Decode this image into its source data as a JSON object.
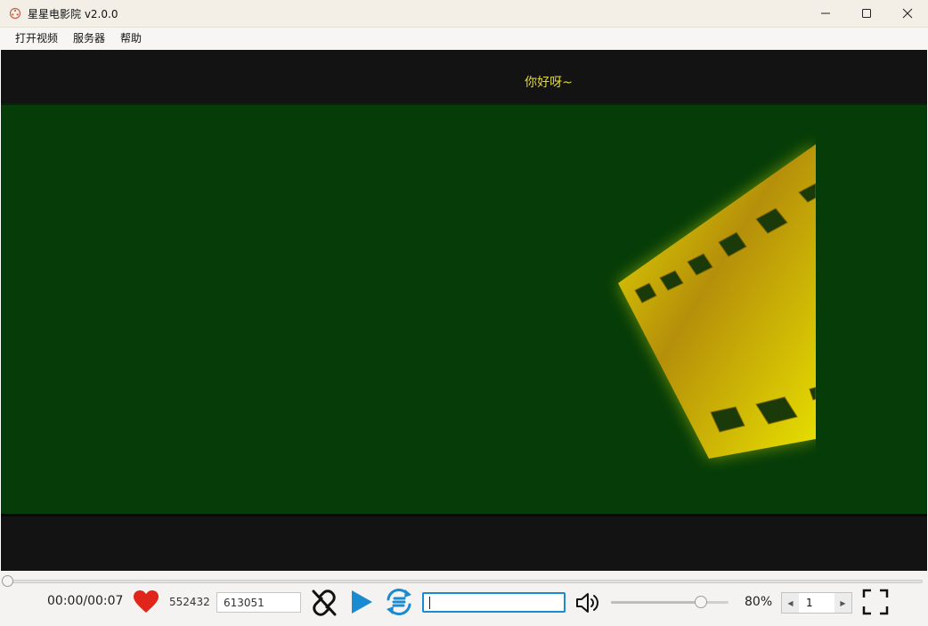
{
  "window": {
    "title": "星星电影院 v2.0.0",
    "icon": "film-reel-icon"
  },
  "menu": {
    "items": [
      {
        "label": "打开视频"
      },
      {
        "label": "服务器"
      },
      {
        "label": "帮助"
      }
    ]
  },
  "player": {
    "subtitle": "你好呀~"
  },
  "controls": {
    "time": "00:00/00:07",
    "seek_progress": 0,
    "like_count": "552432",
    "room_id": "613051",
    "chat_value": "",
    "volume_percent": 80,
    "volume_label": "80%",
    "episode": "1",
    "icons": {
      "like": "heart-icon",
      "link": "unlink-icon",
      "play": "play-icon",
      "sync": "sync-icon",
      "volume": "speaker-icon",
      "fullscreen": "fullscreen-icon"
    }
  },
  "colors": {
    "accent": "#1b8bd1",
    "heart": "#e0261b",
    "subtitle": "#e3d83a",
    "video_bg": "#053c08"
  }
}
